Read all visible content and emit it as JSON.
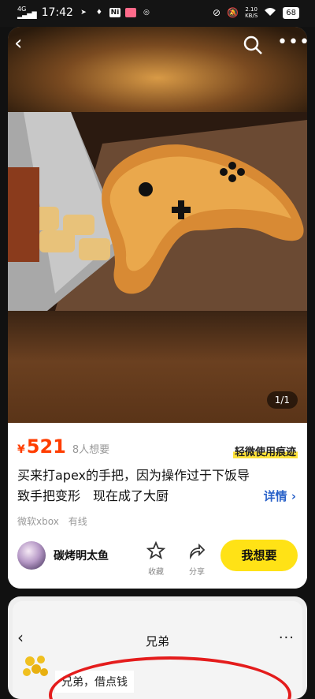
{
  "status_bar": {
    "network": "4G",
    "time": "17:42",
    "icon_ni": "Ni",
    "speed_value": "2.10",
    "speed_unit": "KB/S",
    "battery": "68"
  },
  "nav": {
    "page_counter": "1/1"
  },
  "item": {
    "currency": "¥",
    "price": "521",
    "wants": "8人想要",
    "condition": "轻微使用痕迹",
    "description": "买来打apex的手把，因为操作过于下饭导致手把变形　现在成了大厨",
    "details": "详情 ›",
    "tags": [
      "微软xbox",
      "有线"
    ]
  },
  "seller": {
    "name": "碳烤明太鱼"
  },
  "actions": {
    "favorite": "收藏",
    "share": "分享",
    "want_button": "我想要"
  },
  "second_card": {
    "title": "兄弟",
    "back": "‹",
    "more": "···",
    "bubble_text": "兄弟，借点钱"
  },
  "colors": {
    "price": "#ff3d00",
    "accent_yellow": "#ffe216",
    "link": "#2a62c9",
    "annotation_red": "#e41c1c"
  }
}
